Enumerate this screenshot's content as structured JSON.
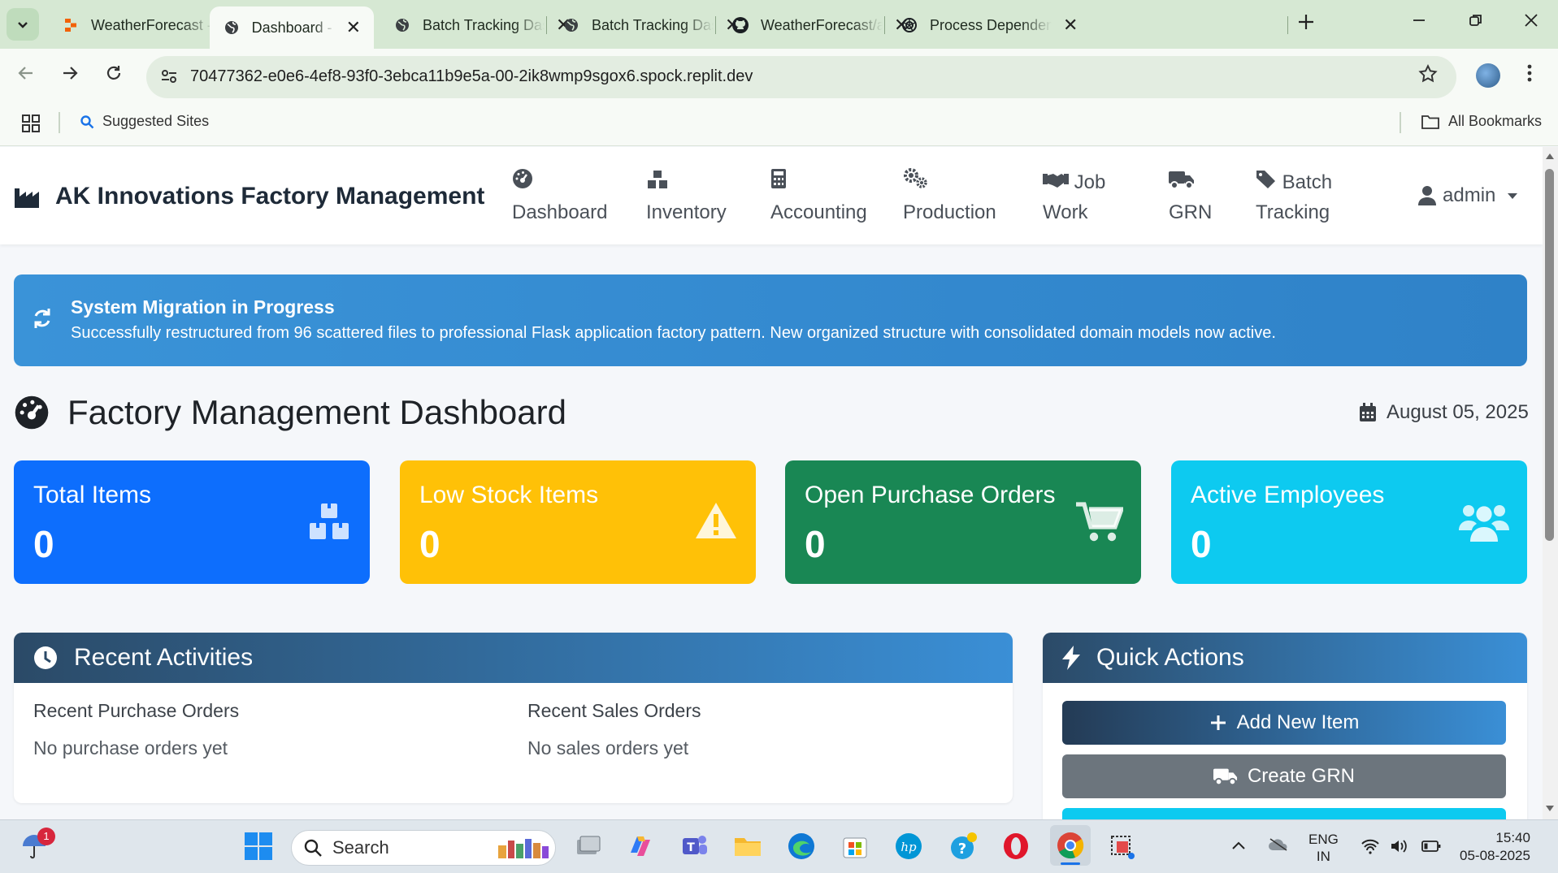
{
  "browser": {
    "tabs": [
      {
        "label": "WeatherForecast - ",
        "icon": "replit-icon"
      },
      {
        "label": "Dashboard - Facto",
        "icon": "globe-icon"
      },
      {
        "label": "Batch Tracking Das",
        "icon": "globe-icon"
      },
      {
        "label": "Batch Tracking Das",
        "icon": "globe-icon"
      },
      {
        "label": "WeatherForecast/a",
        "icon": "github-icon"
      },
      {
        "label": "Process Dependen",
        "icon": "chatgpt-icon"
      }
    ],
    "close_glyph": "✕",
    "url": "70477362-e0e6-4ef8-93f0-3ebca11b9e5a-00-2ik8wmp9sgox6.spock.replit.dev",
    "bookmarks": {
      "suggested": "Suggested Sites",
      "all": "All Bookmarks"
    }
  },
  "navbar": {
    "brand": "AK Innovations Factory Management",
    "items": [
      {
        "line1": "",
        "line2": "Dashboard",
        "icon": "tachometer-icon"
      },
      {
        "line1": "",
        "line2": "Inventory",
        "icon": "boxes-icon"
      },
      {
        "line1": "",
        "line2": "Accounting",
        "icon": "calculator-icon"
      },
      {
        "line1": "",
        "line2": "Production",
        "icon": "cogs-icon"
      },
      {
        "line1": "Job",
        "line2": "Work",
        "icon": "handshake-icon"
      },
      {
        "line1": "",
        "line2": "GRN",
        "icon": "truck-icon"
      },
      {
        "line1": "Batch",
        "line2": "Tracking",
        "icon": "tags-icon"
      }
    ],
    "user": "admin"
  },
  "alert": {
    "title": "System Migration in Progress",
    "text": "Successfully restructured from 96 scattered files to professional Flask application factory pattern. New organized structure with consolidated domain models now active."
  },
  "dashboard": {
    "title": "Factory Management Dashboard",
    "date": "August 05, 2025"
  },
  "stats": [
    {
      "label": "Total Items",
      "value": "0",
      "color": "#0d6efd",
      "icon": "boxes-icon"
    },
    {
      "label": "Low Stock Items",
      "value": "0",
      "color": "#ffc107",
      "icon": "warning-icon"
    },
    {
      "label": "Open Purchase Orders",
      "value": "0",
      "color": "#198754",
      "icon": "cart-icon"
    },
    {
      "label": "Active Employees",
      "value": "0",
      "color": "#0dcaf0",
      "icon": "users-icon"
    }
  ],
  "recent": {
    "title": "Recent Activities",
    "purchase_heading": "Recent Purchase Orders",
    "purchase_empty": "No purchase orders yet",
    "sales_heading": "Recent Sales Orders",
    "sales_empty": "No sales orders yet"
  },
  "quick_actions": {
    "title": "Quick Actions",
    "buttons": [
      {
        "label": "Add New Item",
        "icon": "plus-icon"
      },
      {
        "label": "Create GRN",
        "icon": "truck-icon"
      }
    ]
  },
  "taskbar": {
    "notification_count": "1",
    "search_placeholder": "Search",
    "lang_line1": "ENG",
    "lang_line2": "IN",
    "time": "15:40",
    "date": "05-08-2025"
  }
}
